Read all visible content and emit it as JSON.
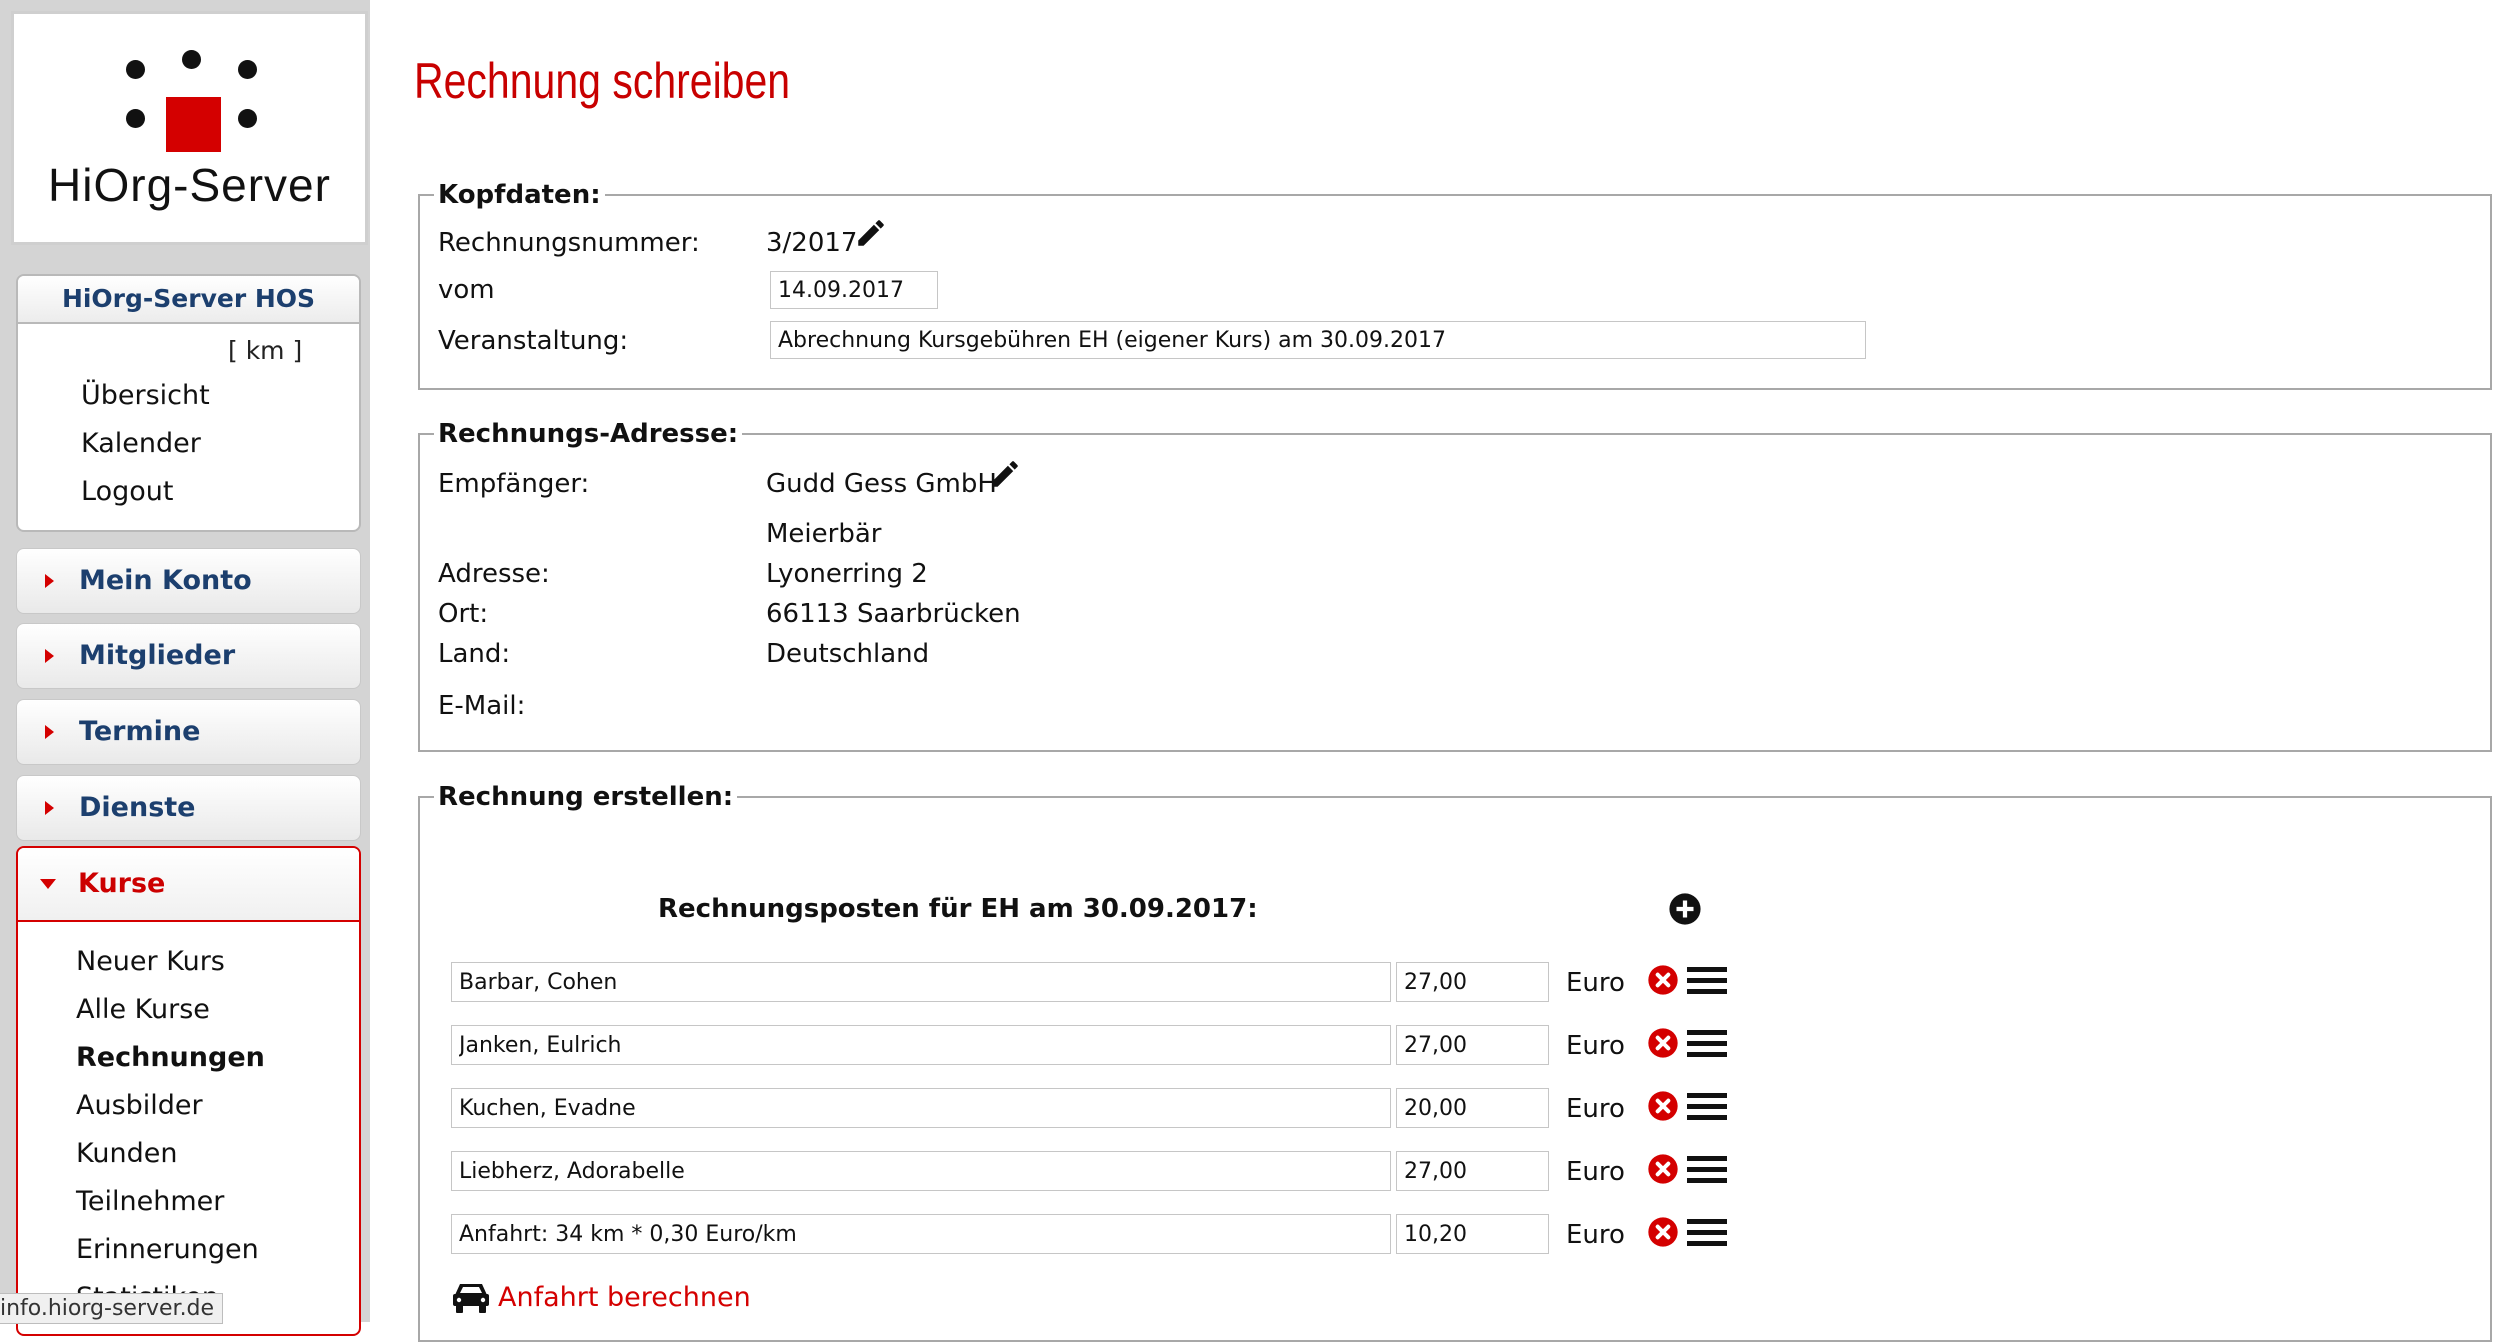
{
  "logo": {
    "text": "HiOrg-Server"
  },
  "org": {
    "title": "HiOrg-Server HOS",
    "short": "[ km ]",
    "links": [
      "Übersicht",
      "Kalender",
      "Logout"
    ]
  },
  "nav": {
    "items": [
      "Mein Konto",
      "Mitglieder",
      "Termine",
      "Dienste"
    ],
    "kurse": {
      "label": "Kurse",
      "sub": [
        "Neuer Kurs",
        "Alle Kurse",
        "Rechnungen",
        "Ausbilder",
        "Kunden",
        "Teilnehmer",
        "Erinnerungen",
        "Statistiken"
      ],
      "active": "Rechnungen"
    }
  },
  "statusbar": "info.hiorg-server.de",
  "page": {
    "title": "Rechnung schreiben"
  },
  "kopfdaten": {
    "legend": "Kopfdaten:",
    "nummer_label": "Rechnungsnummer:",
    "nummer_value": "3/2017",
    "vom_label": "vom",
    "vom_value": "14.09.2017",
    "veranstaltung_label": "Veranstaltung:",
    "veranstaltung_value": "Abrechnung Kursgebühren EH (eigener Kurs) am 30.09.2017"
  },
  "adresse": {
    "legend": "Rechnungs-Adresse:",
    "empfaenger_label": "Empfänger:",
    "empfaenger_value": "Gudd Gess GmbH",
    "zusatz": "Meierbär",
    "adresse_label": "Adresse:",
    "adresse_value": "Lyonerring 2",
    "ort_label": "Ort:",
    "ort_value": "66113 Saarbrücken",
    "land_label": "Land:",
    "land_value": "Deutschland",
    "email_label": "E-Mail:",
    "email_value": ""
  },
  "rechnung": {
    "legend": "Rechnung erstellen:",
    "posten_title": "Rechnungsposten für EH am 30.09.2017:",
    "currency": "Euro",
    "items": [
      {
        "text": "Barbar, Cohen",
        "amount": "27,00"
      },
      {
        "text": "Janken, Eulrich",
        "amount": "27,00"
      },
      {
        "text": "Kuchen, Evadne",
        "amount": "20,00"
      },
      {
        "text": "Liebherz, Adorabelle",
        "amount": "27,00"
      },
      {
        "text": "Anfahrt: 34 km * 0,30 Euro/km",
        "amount": "10,20"
      }
    ],
    "anfahrt_label": "Anfahrt berechnen"
  },
  "colors": {
    "accent": "#d40000",
    "nav_text": "#1c3f6e",
    "title": "#c80000"
  }
}
